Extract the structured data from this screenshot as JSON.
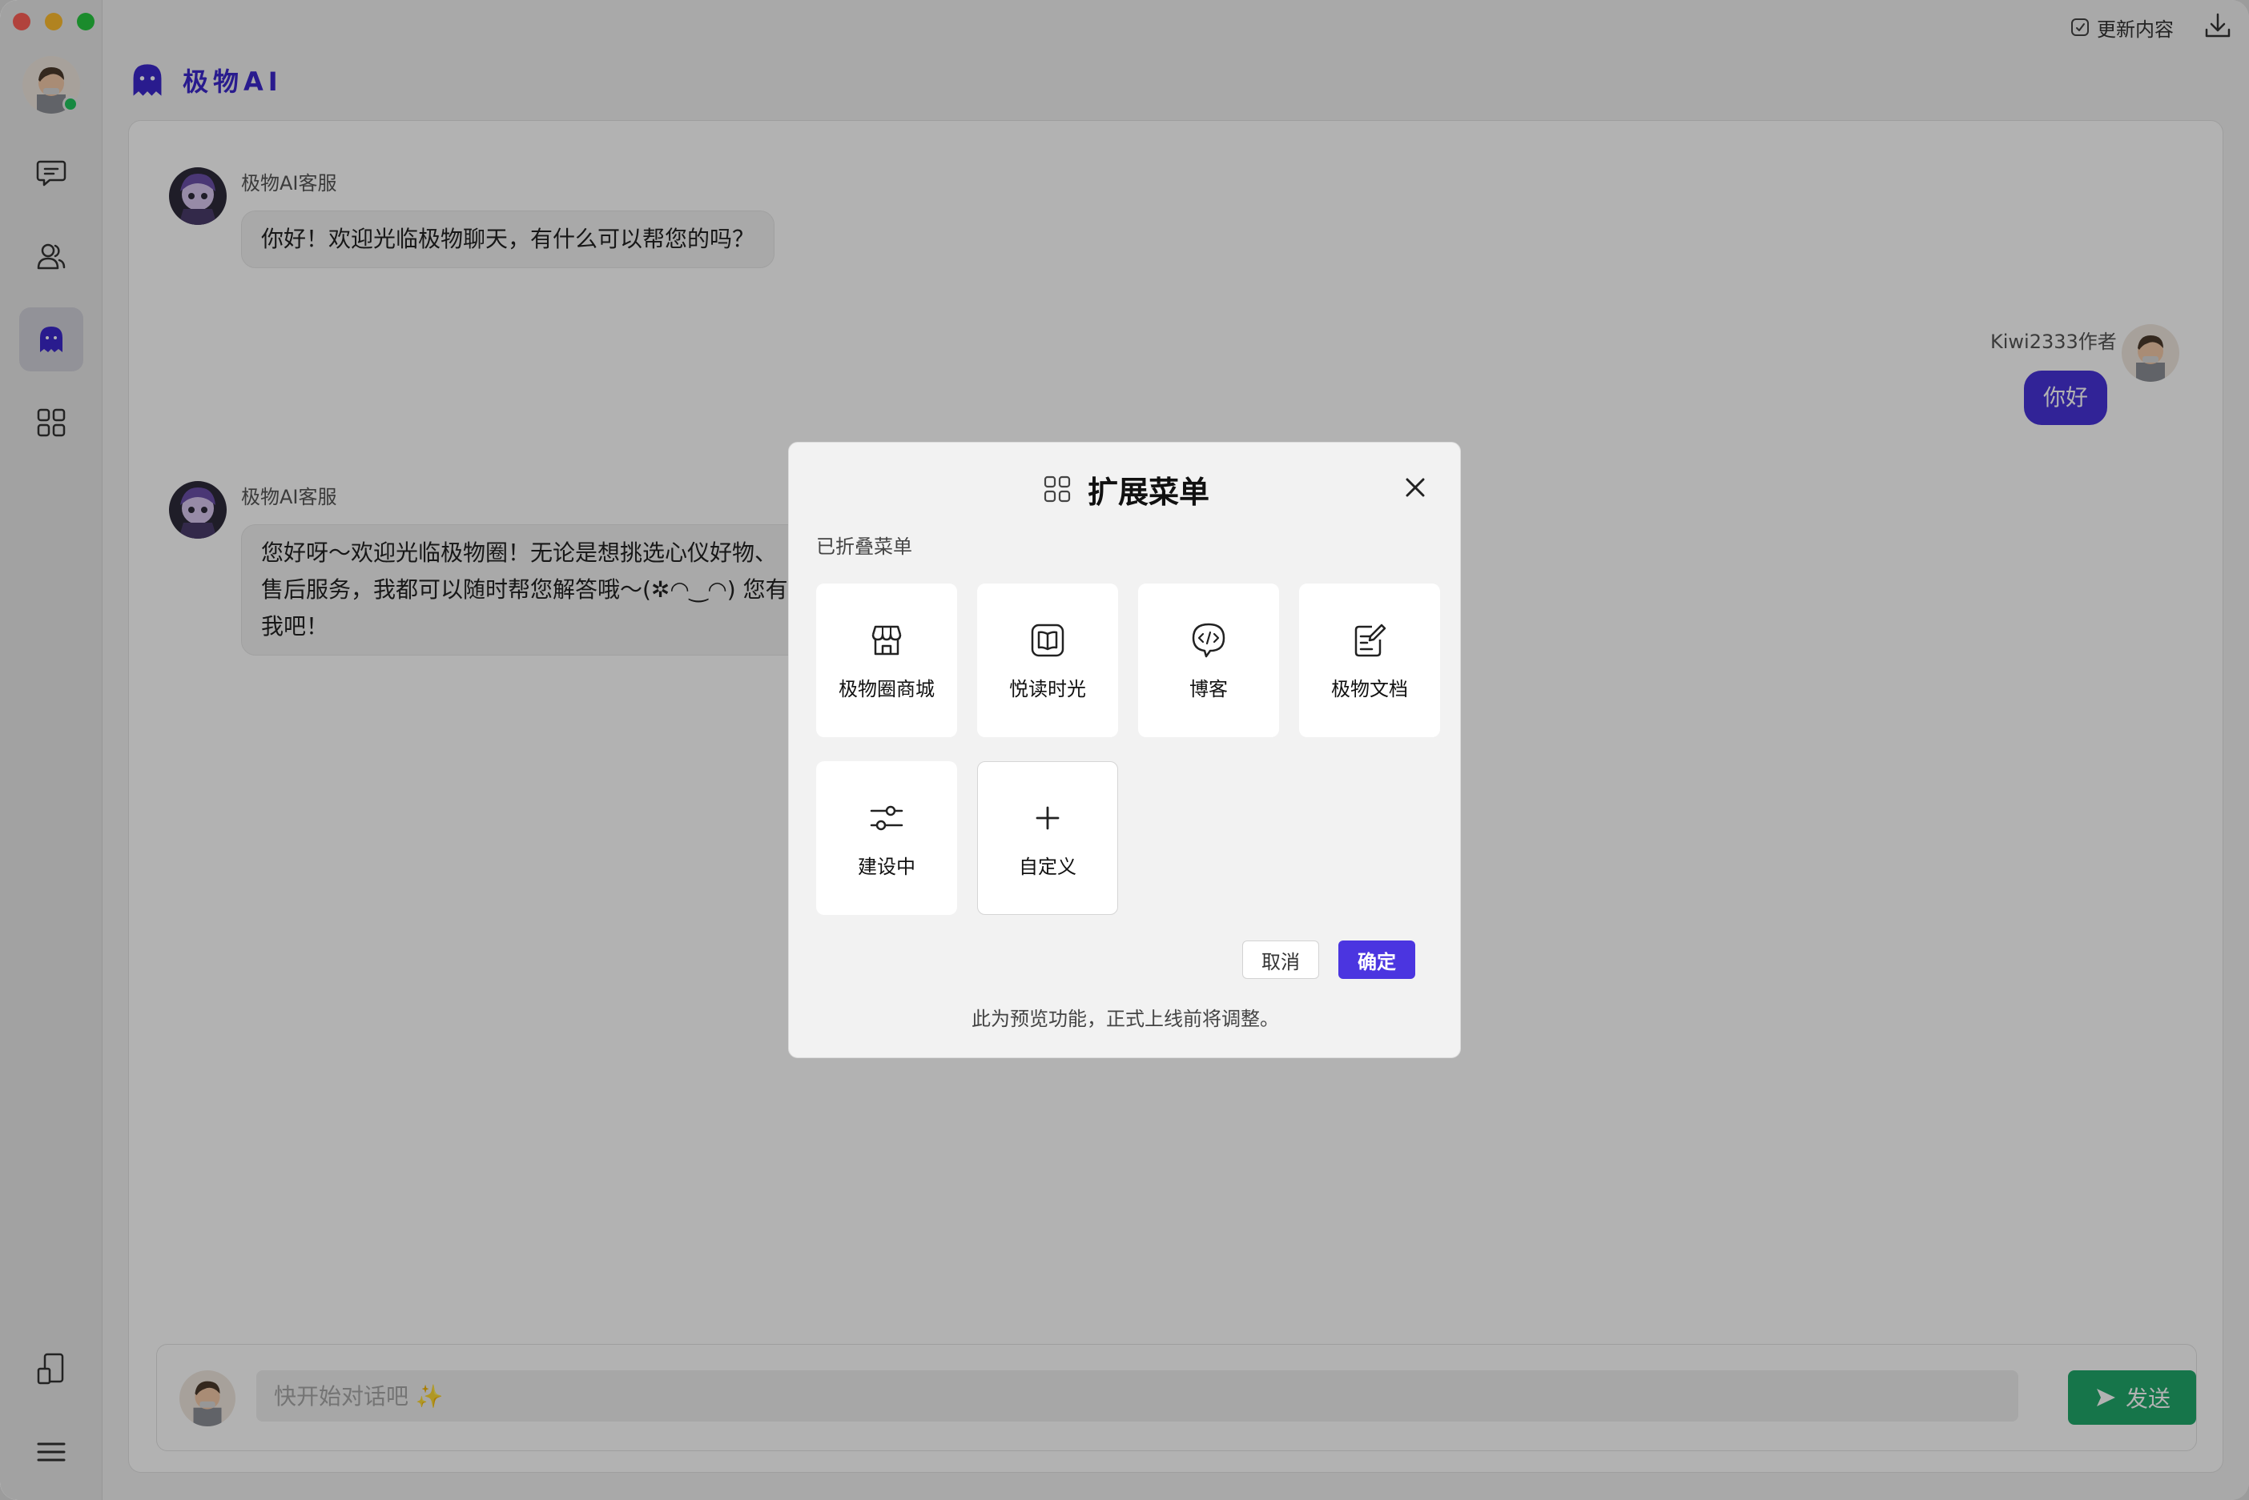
{
  "app": {
    "brand_name": "极物AI",
    "update_label": "更新内容"
  },
  "messages": [
    {
      "sender": "极物AI客服",
      "text": "你好！欢迎光临极物聊天，有什么可以帮您的吗？"
    },
    {
      "sender": "Kiwi2333作者",
      "text": "你好"
    },
    {
      "sender": "极物AI客服",
      "lines": [
        "您好呀～欢迎光临极物圈！无论是想挑选心仪好物、",
        "售后服务，我都可以随时帮您解答哦～(✲◠‿◠) 您有什么需要都可以告诉",
        "我吧！"
      ]
    }
  ],
  "composer": {
    "placeholder": "快开始对话吧 ✨",
    "send_label": "发送"
  },
  "modal": {
    "title": "扩展菜单",
    "section_label": "已折叠菜单",
    "tiles": [
      {
        "label": "极物圈商城",
        "icon": "store-icon"
      },
      {
        "label": "悦读时光",
        "icon": "book-icon"
      },
      {
        "label": "博客",
        "icon": "code-chat-icon"
      },
      {
        "label": "极物文档",
        "icon": "document-edit-icon"
      },
      {
        "label": "建设中",
        "icon": "sliders-icon"
      },
      {
        "label": "自定义",
        "icon": "plus-icon"
      }
    ],
    "cancel_label": "取消",
    "confirm_label": "确定",
    "note": "此为预览功能，正式上线前将调整。"
  },
  "colors": {
    "brand": "#3b28cc",
    "user_bubble": "#4733d8",
    "send_button": "#20a86b",
    "confirm_button": "#4b35e0"
  }
}
